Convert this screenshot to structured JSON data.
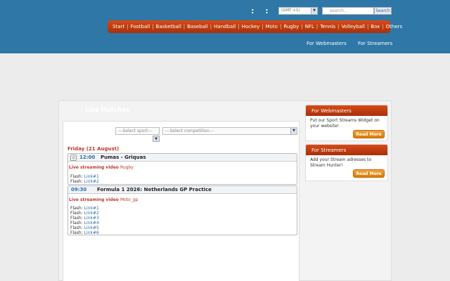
{
  "header": {
    "clock": [
      ":",
      ":"
    ],
    "timezone": "(GMT +1)",
    "search_placeholder": "search...",
    "search_button": "Search"
  },
  "nav": [
    "Start",
    "Football",
    "Basketball",
    "Baseball",
    "Handball",
    "Hockey",
    "Moto",
    "Rugby",
    "NFL",
    "Tennis",
    "Volleyball",
    "Box",
    "Others"
  ],
  "toplinks": {
    "webmasters": "For Webmasters",
    "streamers": "For Streamers"
  },
  "main": {
    "title": "Live Matches",
    "select_sport": "---Select sport---",
    "select_competition": "---Select competition---",
    "day": "Friday (21 August)"
  },
  "matches": [
    {
      "time": "12:00",
      "name": "Pumas - Griquas",
      "live_label": "Live streaming video",
      "sport": "Rugby",
      "flash_label": "Flash:",
      "links": [
        "Link#1",
        "Link#2"
      ]
    },
    {
      "time": "09:30",
      "name": "Formula 1 2026: Netherlands GP Practice",
      "live_label": "Live streaming video",
      "sport": "Moto_gp",
      "flash_label": "Flash:",
      "links": [
        "Link#1",
        "Link#2",
        "Link#3",
        "Link#4",
        "Link#5",
        "Link#6"
      ]
    }
  ],
  "sidebar": {
    "webmasters": {
      "title": "For Webmasters",
      "text": "Put our Sport Streams Widget on your website!",
      "button": "Read More"
    },
    "streamers": {
      "title": "For Streamers",
      "text": "Add your Stream adresses to Stream Hunter!",
      "button": "Read More"
    }
  },
  "colors": {
    "header_blue": "#2f77a6",
    "nav_orange": "#c53d11",
    "link_blue": "#2c6ea7",
    "accent_red": "#c0392b"
  }
}
